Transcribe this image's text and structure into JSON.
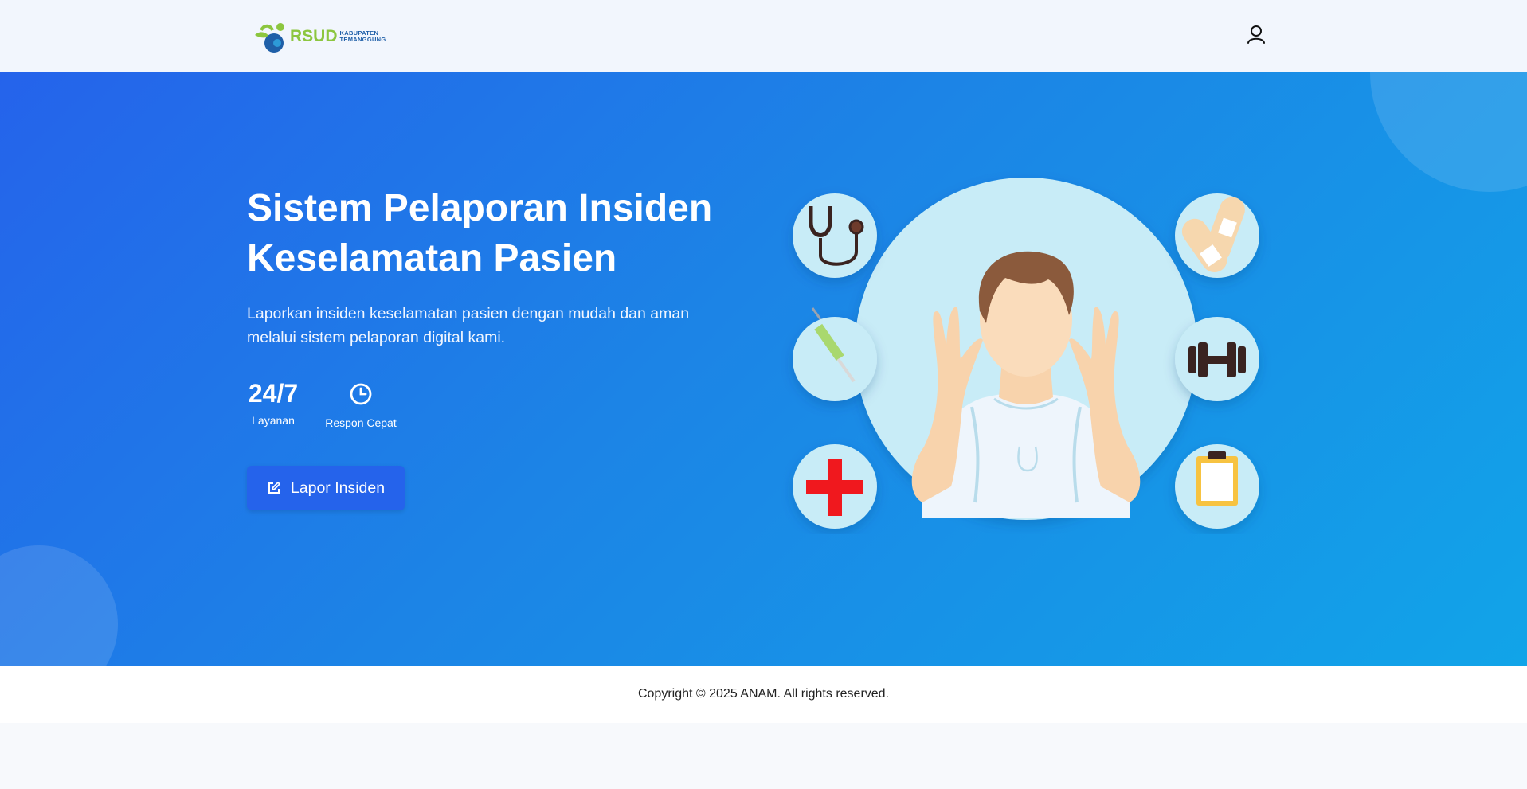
{
  "header": {
    "logo": {
      "word": "RSUD",
      "sub_line1": "KABUPATEN",
      "sub_line2": "TEMANGGUNG"
    },
    "user_icon": "user-icon"
  },
  "hero": {
    "title_line1": "Sistem Pelaporan Insiden",
    "title_line2": "Keselamatan Pasien",
    "description": "Laporkan insiden keselamatan pasien dengan mudah dan aman melalui sistem pelaporan digital kami.",
    "stats": [
      {
        "value": "24/7",
        "label": "Layanan"
      },
      {
        "icon": "clock-icon",
        "label": "Respon Cepat"
      }
    ],
    "cta_label": "Lapor Insiden",
    "cta_icon": "edit-icon",
    "illustration_icons": [
      "stethoscope-icon",
      "bandage-icon",
      "syringe-icon",
      "dumbbell-icon",
      "medical-cross-icon",
      "clipboard-icon"
    ]
  },
  "footer": {
    "copyright": "Copyright © 2025 ANAM. All rights reserved."
  },
  "colors": {
    "primary": "#2563eb",
    "hero_gradient_end": "#11a4e8",
    "logo_green": "#8cc63f",
    "logo_blue": "#1f5fa8"
  }
}
